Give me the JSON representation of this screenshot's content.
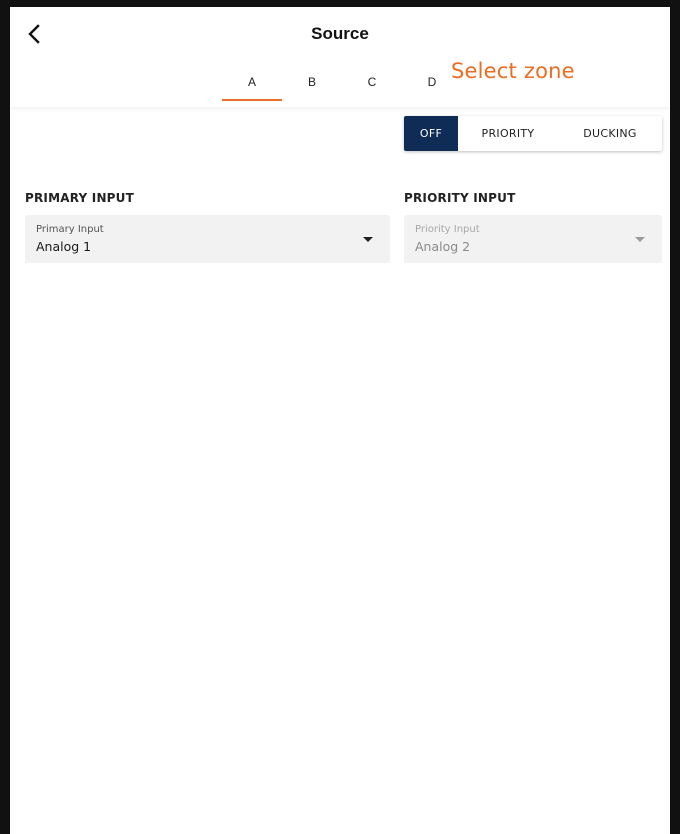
{
  "header": {
    "title": "Source",
    "back_icon": "chevron-left-icon"
  },
  "tabs": [
    {
      "label": "A",
      "active": true
    },
    {
      "label": "B",
      "active": false
    },
    {
      "label": "C",
      "active": false
    },
    {
      "label": "D",
      "active": false
    }
  ],
  "hint": {
    "text": "Select zone",
    "color": "#ee6c21"
  },
  "mode": {
    "options": [
      "OFF",
      "PRIORITY",
      "DUCKING"
    ],
    "selected": "OFF",
    "accent": "#0f2c57"
  },
  "primary": {
    "section_label": "PRIMARY INPUT",
    "field_label": "Primary Input",
    "value": "Analog 1"
  },
  "priority": {
    "section_label": "PRIORITY INPUT",
    "field_label": "Priority Input",
    "value": "Analog 2",
    "disabled": true
  },
  "colors": {
    "tab_indicator": "#e8702a"
  }
}
